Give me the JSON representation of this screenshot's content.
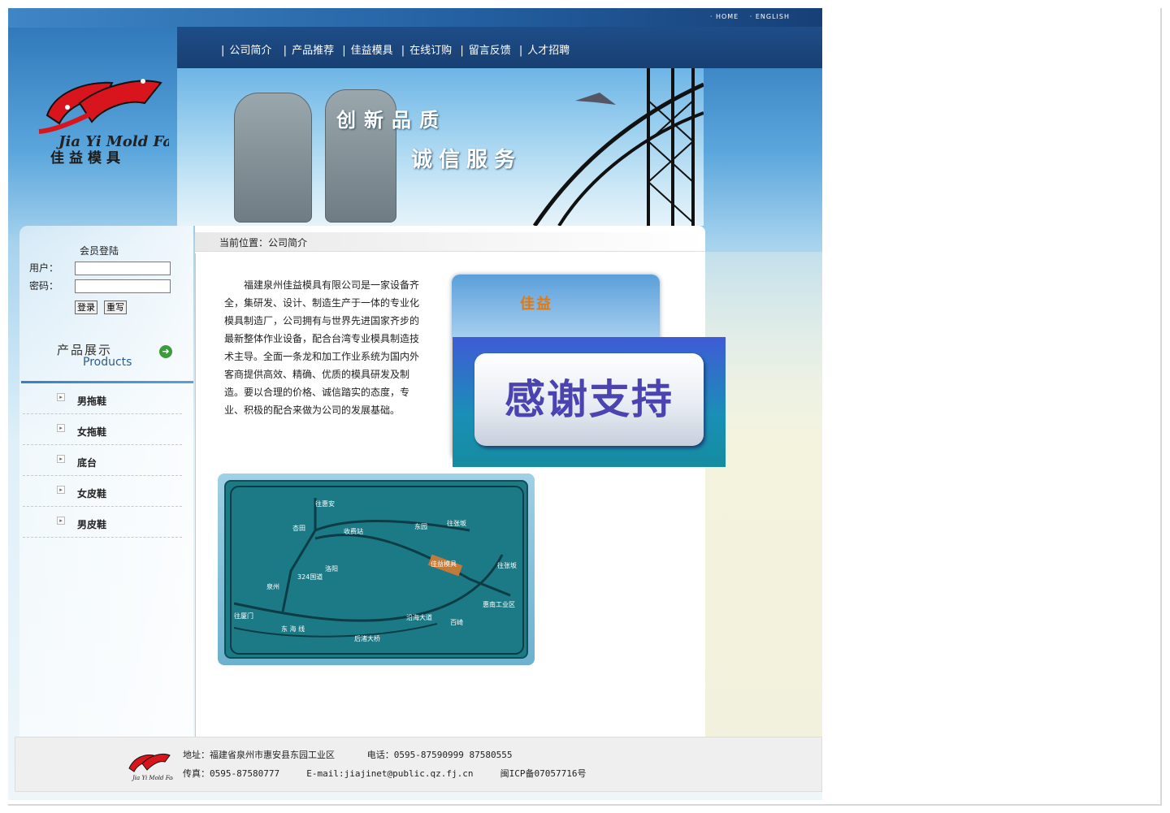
{
  "top_links": [
    "· HOME",
    "· ENGLISH"
  ],
  "nav": [
    "公司简介",
    "产品推荐",
    "佳益模具",
    "在线订购",
    "留言反馈",
    "人才招聘"
  ],
  "logo": {
    "brand_en": "Jia Yi Mold Factory",
    "brand_cn": "佳益模具"
  },
  "banner": {
    "slogan_1": "创新品质",
    "slogan_2": "诚信服务"
  },
  "login": {
    "title": "会员登陆",
    "user_label": "用户：",
    "pass_label": "密码：",
    "login_button": "登录",
    "reset_button": "重写"
  },
  "products": {
    "title_cn": "产品展示",
    "title_en": "Products",
    "items": [
      "男拖鞋",
      "女拖鞋",
      "底台",
      "女皮鞋",
      "男皮鞋"
    ]
  },
  "breadcrumb": "当前位置：公司简介",
  "intro": "福建泉州佳益模具有限公司是一家设备齐全，集研发、设计、制造生产于一体的专业化模具制造厂，公司拥有与世界先进国家齐步的最新整体作业设备，配合台湾专业模具制造技术主导。全面一条龙和加工作业系统为国内外客商提供高效、精确、优质的模具研发及制造。要以合理的价格、诚信踏实的态度，专业、积极的配合来做为公司的发展基础。",
  "photo_sign": "佳益",
  "map_labels": [
    "往惠安",
    "杏田",
    "收费站",
    "东园",
    "往张坂",
    "洛阳",
    "324国道",
    "泉州",
    "佳益模具",
    "往张坂",
    "往厦门",
    "惠南工业区",
    "东 海 线",
    "沿海大道",
    "百崎",
    "后渚大桥"
  ],
  "overlay_text": "感谢支持",
  "footer": {
    "address": "地址：福建省泉州市惠安县东园工业区",
    "phone": "电话：0595-87590999 87580555",
    "fax": "传真：0595-87580777",
    "email": "E-mail:jiajinet@public.qz.fj.cn",
    "icp": "闽ICP备07057716号"
  },
  "colors": {
    "nav_bg": "#1e4d88",
    "overlay_text": "#4a43b0",
    "overlay_bg": "#1a8fb7",
    "logo_red": "#d8151d"
  }
}
